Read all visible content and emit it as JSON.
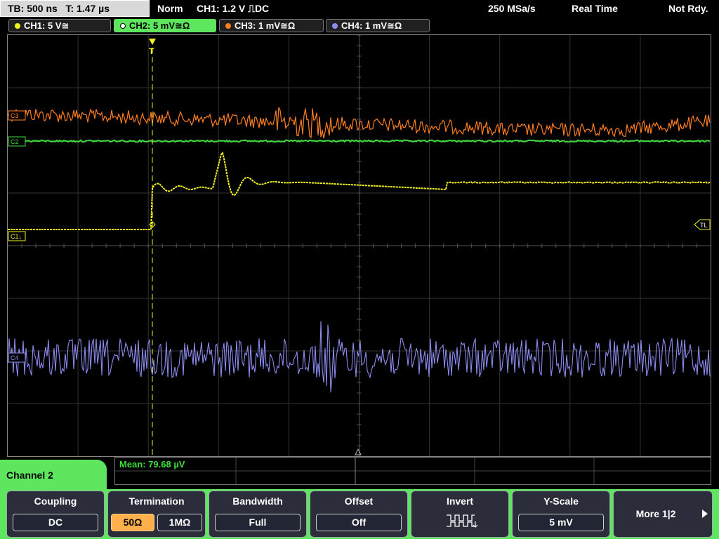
{
  "statusbar": {
    "timebase": "TB: 500 ns",
    "trigger_time": "T: 1.47 µs",
    "trigger_mode": "Norm",
    "trigger_source": "CH1: 1.2 V ⎍DC",
    "sample_rate": "250 MSa/s",
    "acq_mode": "Real Time",
    "status": "Not Rdy."
  },
  "channels": [
    {
      "label": "CH1: 5 V≅",
      "color": "#f2f21c"
    },
    {
      "label": "CH2: 5 mV≅Ω",
      "color": "#3ddc3d"
    },
    {
      "label": "CH3: 1 mV≅Ω",
      "color": "#ff7f20"
    },
    {
      "label": "CH4: 1 mV≅Ω",
      "color": "#8c8cf0"
    }
  ],
  "markers": {
    "trigger_level": "TL",
    "ch1_marker": "C1↓",
    "ch2_marker": "C2",
    "ch3_marker": "C3",
    "ch4_marker": "C4",
    "trigger_position": "T"
  },
  "measurement": {
    "text": "Mean: 79.68 µV"
  },
  "channel_tab": "Channel 2",
  "softkeys": {
    "coupling": {
      "title": "Coupling",
      "value": "DC"
    },
    "termination": {
      "title": "Termination",
      "value_a": "50Ω",
      "value_b": "1MΩ"
    },
    "bandwidth": {
      "title": "Bandwidth",
      "value": "Full"
    },
    "offset": {
      "title": "Offset",
      "value": "Off"
    },
    "invert": {
      "title": "Invert",
      "icon": "inverted-square-wave-icon"
    },
    "yscale": {
      "title": "Y-Scale",
      "value": "5 mV"
    },
    "more": {
      "label": "More 1|2"
    }
  }
}
